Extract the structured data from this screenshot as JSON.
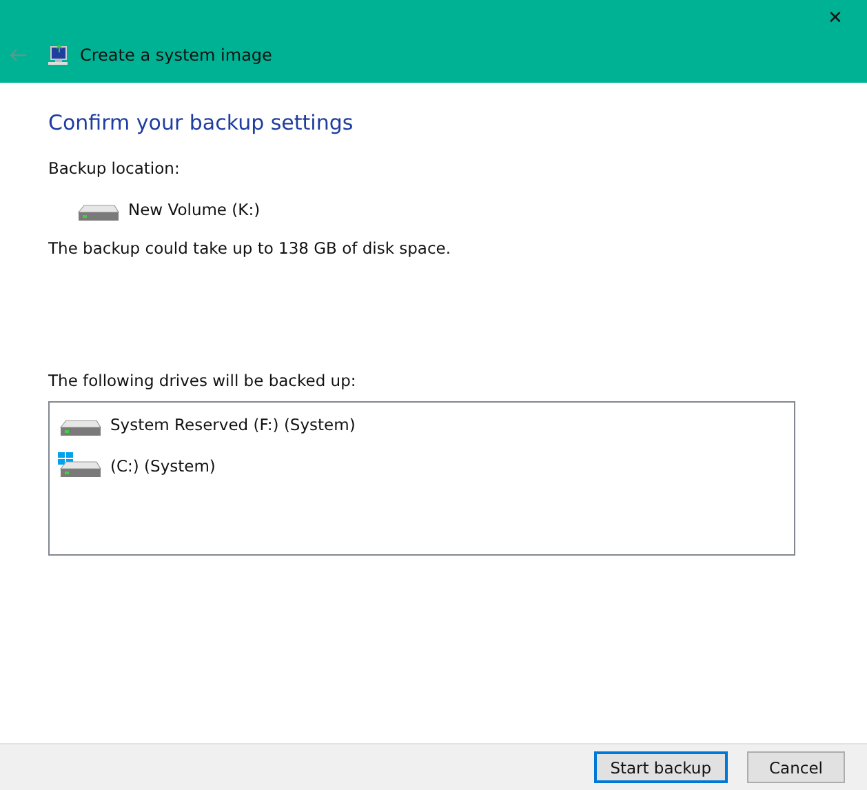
{
  "window": {
    "close_glyph": "✕",
    "title": "Create a system image"
  },
  "heading": "Confirm your backup settings",
  "location": {
    "label": "Backup location:",
    "drive": "New Volume (K:)"
  },
  "space_note": "The backup could take up to 138 GB of disk space.",
  "drives": {
    "label": "The following drives will be backed up:",
    "items": [
      {
        "kind": "drive",
        "name": "System Reserved (F:) (System)"
      },
      {
        "kind": "windows-drive",
        "name": "(C:) (System)"
      }
    ]
  },
  "buttons": [
    {
      "label": "Start backup",
      "default": true
    },
    {
      "label": "Cancel",
      "default": false
    }
  ]
}
